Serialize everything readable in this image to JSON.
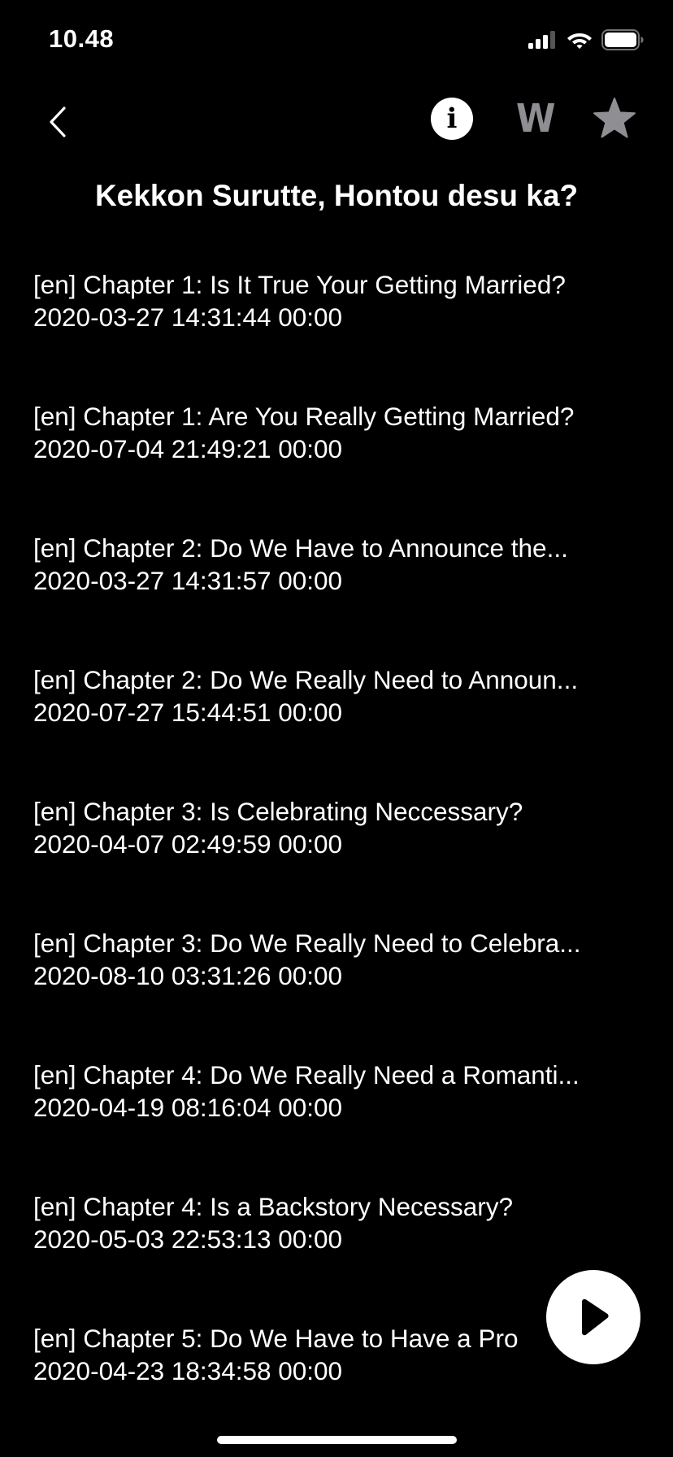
{
  "status_bar": {
    "time": "10.48"
  },
  "nav": {
    "back_icon": "chevron-left-icon",
    "actions": [
      {
        "name": "info-button",
        "icon": "info-icon",
        "label": "i"
      },
      {
        "name": "wiki-button",
        "icon": "w-letter-icon",
        "label": "W"
      },
      {
        "name": "favorite-button",
        "icon": "star-icon"
      }
    ],
    "icon_color_muted": "#8e8e93"
  },
  "title": "Kekkon Surutte, Hontou desu ka?",
  "chapters": [
    {
      "title": "[en] Chapter 1: Is It True Your Getting Married?",
      "date": "2020-03-27 14:31:44 00:00"
    },
    {
      "title": "[en] Chapter 1: Are You Really Getting Married?",
      "date": "2020-07-04 21:49:21 00:00"
    },
    {
      "title": "[en] Chapter 2: Do We Have to Announce the...",
      "date": "2020-03-27 14:31:57 00:00"
    },
    {
      "title": "[en] Chapter 2: Do We Really Need to Announ...",
      "date": "2020-07-27 15:44:51 00:00"
    },
    {
      "title": "[en] Chapter 3: Is Celebrating Neccessary?",
      "date": "2020-04-07 02:49:59 00:00"
    },
    {
      "title": "[en] Chapter 3: Do We Really Need to Celebra...",
      "date": "2020-08-10 03:31:26 00:00"
    },
    {
      "title": "[en] Chapter 4: Do We Really Need a Romanti...",
      "date": "2020-04-19 08:16:04 00:00"
    },
    {
      "title": "[en] Chapter 4: Is a Backstory Necessary?",
      "date": "2020-05-03 22:53:13 00:00"
    },
    {
      "title": "[en] Chapter 5: Do We Have to Have a Pro",
      "date": "2020-04-23 18:34:58 00:00"
    }
  ],
  "fab": {
    "icon": "play-icon"
  },
  "colors": {
    "background": "#000000",
    "text": "#ffffff",
    "muted_icon": "#8e8e93"
  }
}
